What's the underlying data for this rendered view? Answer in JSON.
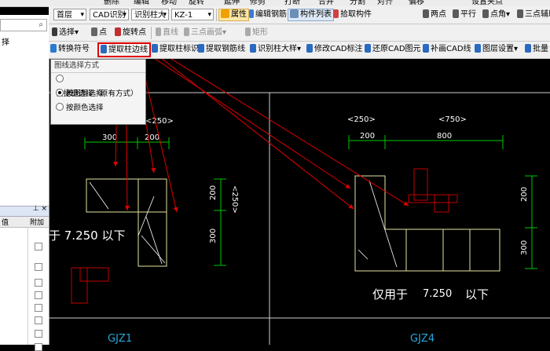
{
  "menu": {
    "items": [
      "删除",
      "编辑",
      "移动",
      "旋转",
      "延伸",
      "修剪",
      "打断",
      "合并",
      "分割",
      "对齐",
      "偏移",
      "设置夹点"
    ]
  },
  "toolbar1": {
    "floor": "首层",
    "cad_recognize": "CAD识别",
    "recognize_column": "识别柱大",
    "component": "KZ-1",
    "attribute": "属性",
    "edit_rebar": "编辑钢筋",
    "component_list": "构件列表",
    "pick_component": "拾取构件",
    "two_points": "两点",
    "parallel": "平行",
    "point_angle": "点角",
    "three_point_aux": "三点辅助"
  },
  "toolbar2": {
    "select": "选择",
    "point": "点",
    "rotate_point": "旋转点",
    "line": "直线",
    "three_point_arc": "三点画弧",
    "rectangle": "矩形"
  },
  "toolbar3": {
    "convert_symbol": "转换符号",
    "extract_column_edge": "提取柱边线",
    "extract_column_label": "提取柱标识",
    "extract_rebar_line": "提取钢筋线",
    "recognize_column_table": "识别柱大样",
    "modify_cad_label": "修改CAD标注",
    "restore_cad": "还原CAD图元",
    "fill_cad_line": "补画CAD线",
    "layer_settings": "图层设置",
    "batch": "批量"
  },
  "popup": {
    "title": "图线选择方式",
    "options": [
      {
        "label": "快捷键选择（原有方式）",
        "selected": false
      },
      {
        "label": "按图层选择",
        "selected": true
      },
      {
        "label": "按颜色选择",
        "selected": false
      }
    ]
  },
  "left_panel": {
    "text1": "择",
    "col_left": "值",
    "col_right": "附加",
    "pin": "⊥ ×"
  },
  "drawing": {
    "left": {
      "label_250": "<250>",
      "dim_300": "300",
      "dim_200": "200",
      "vdim_200": "200",
      "vdim_300": "300",
      "vlabel": "<250>",
      "note": "于 7.250  以下",
      "name": "GJZ1"
    },
    "right": {
      "label_250": "<250>",
      "label_750": "<750>",
      "dim_200": "200",
      "dim_800": "800",
      "vdim_200": "200",
      "vdim_300": "300",
      "note_prefix": "仅用于",
      "note_value": "7.250",
      "note_suffix": "以下",
      "name": "GJZ4"
    }
  },
  "colors": {
    "cad_yellow": "#e5e5a0",
    "cad_green": "#00c800",
    "cad_red": "#c00000",
    "cad_cyan": "#28a8d8",
    "highlight_red": "#e00000"
  }
}
